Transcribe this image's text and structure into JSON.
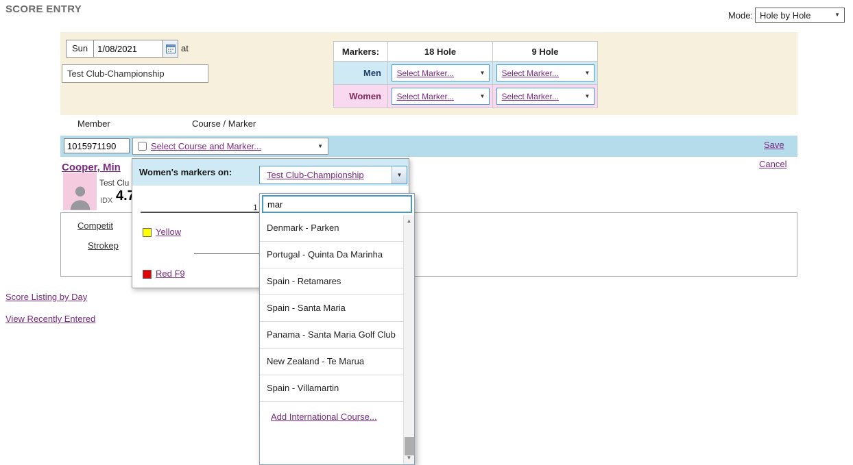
{
  "page": {
    "title": "SCORE ENTRY",
    "mode_label": "Mode:",
    "mode_value": "Hole by Hole"
  },
  "entry": {
    "day": "Sun",
    "date": "1/08/2021",
    "at": "at",
    "course_name": "Test Club-Championship",
    "markers": {
      "header": [
        "Markers:",
        "18 Hole",
        "9 Hole"
      ],
      "men_label": "Men",
      "women_label": "Women",
      "select_marker": "Select Marker..."
    }
  },
  "grid": {
    "member_header": "Member",
    "course_header": "Course / Marker",
    "member_id": "1015971190",
    "select_course": "Select Course and Marker...",
    "save": "Save",
    "cancel": "Cancel"
  },
  "member": {
    "name": "Cooper, Min",
    "club": "Test Clu",
    "idx_label": "IDX",
    "idx_value": "4.7",
    "competition": "Competit",
    "strokeplay": "Strokep",
    "partial_text": "1"
  },
  "popup": {
    "header": "Women's markers on:",
    "course": "Test Club-Championship",
    "search": "mar",
    "tee_yellow": "Yellow",
    "tee_red": "Red F9",
    "courses": [
      "Denmark - Parken",
      "Portugal - Quinta Da Marinha",
      "Spain - Retamares",
      "Spain - Santa Maria",
      "Panama - Santa Maria Golf Club",
      "New Zealand - Te Marua",
      "Spain - Villamartin"
    ],
    "add_course": "Add International Course..."
  },
  "footer_links": {
    "score_listing": "Score Listing by Day",
    "recently_entered": "View Recently Entered"
  },
  "icons": {
    "chevron_down": "▼",
    "chevron_up": "▲"
  },
  "colors": {
    "accent_purple": "#7b2982",
    "panel_beige": "#f7f0dd",
    "row_blue": "#b5dcea",
    "header_blue": "#cfe9f5",
    "row_pink": "#f9d9ef",
    "border_blue": "#4a98c6",
    "tee_yellow": "#ffff00",
    "tee_red": "#e00404"
  }
}
